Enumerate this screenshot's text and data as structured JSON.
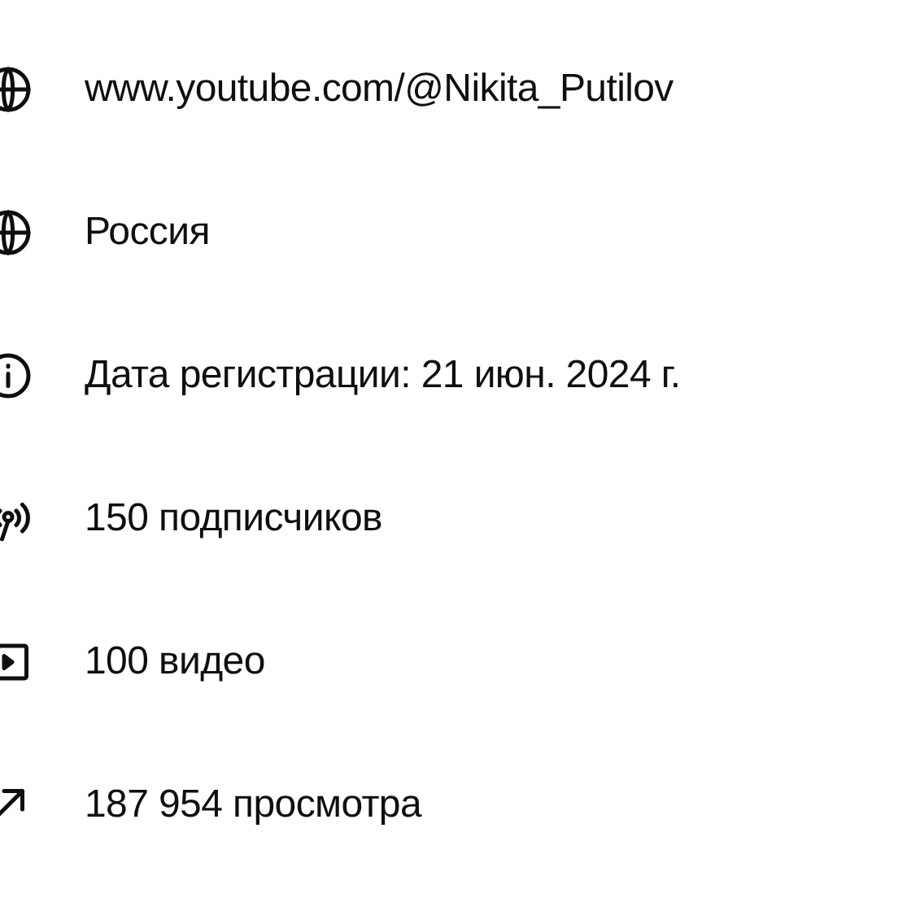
{
  "details": [
    {
      "kind": "link",
      "text": "www.youtube.com/@Nikita_Putilov"
    },
    {
      "kind": "country",
      "text": "Россия"
    },
    {
      "kind": "joined",
      "text": "Дата регистрации: 21 июн. 2024 г."
    },
    {
      "kind": "subscribers",
      "text": "150 подписчиков"
    },
    {
      "kind": "videos",
      "text": "100 видео"
    },
    {
      "kind": "views",
      "text": "187 954 просмотра"
    }
  ]
}
